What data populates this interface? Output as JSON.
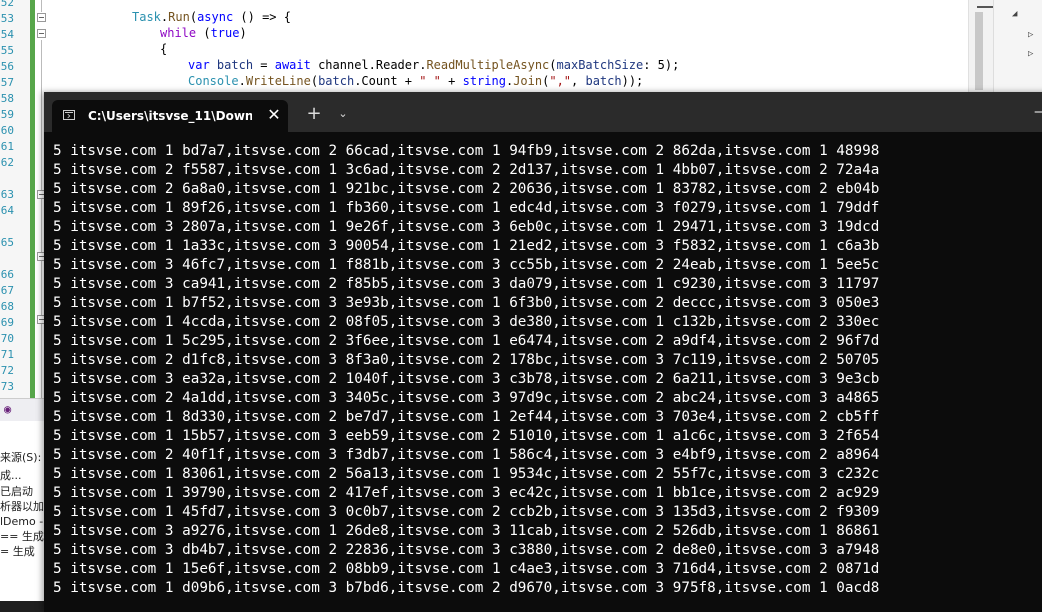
{
  "editor": {
    "line_numbers": [
      "52",
      "53",
      "54",
      "55",
      "56",
      "57",
      "58",
      "59",
      "60",
      "61",
      "62",
      "63",
      "64",
      "65",
      "66",
      "67",
      "68",
      "69",
      "70",
      "71",
      "72",
      "73"
    ],
    "code": {
      "line1": [
        "Task",
        ".",
        "Run",
        "(",
        "async",
        " () => {"
      ],
      "line2": [
        "while",
        " (",
        "true",
        ")"
      ],
      "line3": "{",
      "line4": [
        "var",
        " ",
        "batch",
        " = ",
        "await",
        " channel.Reader.",
        "ReadMultipleAsync",
        "(",
        "maxBatchSize",
        ": 5);"
      ],
      "line5": [
        "Console",
        ".",
        "WriteLine",
        "(",
        "batch",
        ".Count + ",
        "\" \"",
        " + ",
        "string",
        ".",
        "Join",
        "(",
        "\",\"",
        ", ",
        "batch",
        "));"
      ]
    }
  },
  "output_pane": {
    "lines": [
      "来源(S):",
      "成...",
      " 已启动",
      "析器以加",
      "lDemo -",
      "== 生成",
      "= 生成"
    ]
  },
  "terminal": {
    "tab_title": "C:\\Users\\itsvse_11\\Downloads\\",
    "close_glyph": "✕",
    "new_tab_glyph": "+",
    "dropdown_glyph": "⌄",
    "minimize_glyph": "—",
    "lines": [
      "5 itsvse.com 1 bd7a7,itsvse.com 2 66cad,itsvse.com 1 94fb9,itsvse.com 2 862da,itsvse.com 1 48998",
      "5 itsvse.com 2 f5587,itsvse.com 1 3c6ad,itsvse.com 2 2d137,itsvse.com 1 4bb07,itsvse.com 2 72a4a",
      "5 itsvse.com 2 6a8a0,itsvse.com 1 921bc,itsvse.com 2 20636,itsvse.com 1 83782,itsvse.com 2 eb04b",
      "5 itsvse.com 1 89f26,itsvse.com 1 fb360,itsvse.com 1 edc4d,itsvse.com 3 f0279,itsvse.com 1 79ddf",
      "5 itsvse.com 3 2807a,itsvse.com 1 9e26f,itsvse.com 3 6eb0c,itsvse.com 1 29471,itsvse.com 3 19dcd",
      "5 itsvse.com 1 1a33c,itsvse.com 3 90054,itsvse.com 1 21ed2,itsvse.com 3 f5832,itsvse.com 1 c6a3b",
      "5 itsvse.com 3 46fc7,itsvse.com 1 f881b,itsvse.com 3 cc55b,itsvse.com 2 24eab,itsvse.com 1 5ee5c",
      "5 itsvse.com 3 ca941,itsvse.com 2 f85b5,itsvse.com 3 da079,itsvse.com 1 c9230,itsvse.com 3 11797",
      "5 itsvse.com 1 b7f52,itsvse.com 3 3e93b,itsvse.com 1 6f3b0,itsvse.com 2 deccc,itsvse.com 3 050e3",
      "5 itsvse.com 1 4ccda,itsvse.com 2 08f05,itsvse.com 3 de380,itsvse.com 1 c132b,itsvse.com 2 330ec",
      "5 itsvse.com 1 5c295,itsvse.com 2 3f6ee,itsvse.com 1 e6474,itsvse.com 2 a9df4,itsvse.com 2 96f7d",
      "5 itsvse.com 2 d1fc8,itsvse.com 3 8f3a0,itsvse.com 2 178bc,itsvse.com 3 7c119,itsvse.com 2 50705",
      "5 itsvse.com 3 ea32a,itsvse.com 2 1040f,itsvse.com 3 c3b78,itsvse.com 2 6a211,itsvse.com 3 9e3cb",
      "5 itsvse.com 2 4a1dd,itsvse.com 3 3405c,itsvse.com 3 97d9c,itsvse.com 2 abc24,itsvse.com 3 a4865",
      "5 itsvse.com 1 8d330,itsvse.com 2 be7d7,itsvse.com 1 2ef44,itsvse.com 3 703e4,itsvse.com 2 cb5ff",
      "5 itsvse.com 1 15b57,itsvse.com 3 eeb59,itsvse.com 2 51010,itsvse.com 1 a1c6c,itsvse.com 3 2f654",
      "5 itsvse.com 2 40f1f,itsvse.com 3 f3db7,itsvse.com 1 586c4,itsvse.com 3 e4bf9,itsvse.com 2 a8964",
      "5 itsvse.com 1 83061,itsvse.com 2 56a13,itsvse.com 1 9534c,itsvse.com 2 55f7c,itsvse.com 3 c232c",
      "5 itsvse.com 1 39790,itsvse.com 2 417ef,itsvse.com 3 ec42c,itsvse.com 1 bb1ce,itsvse.com 2 ac929",
      "5 itsvse.com 1 45fd7,itsvse.com 3 0c0b7,itsvse.com 2 ccb2b,itsvse.com 3 135d3,itsvse.com 2 f9309",
      "5 itsvse.com 3 a9276,itsvse.com 1 26de8,itsvse.com 3 11cab,itsvse.com 2 526db,itsvse.com 1 86861",
      "5 itsvse.com 3 db4b7,itsvse.com 2 22836,itsvse.com 3 c3880,itsvse.com 2 de8e0,itsvse.com 3 a7948",
      "5 itsvse.com 1 15e6f,itsvse.com 2 08bb9,itsvse.com 1 c4ae3,itsvse.com 3 716d4,itsvse.com 2 0871d",
      "5 itsvse.com 1 d09b6,itsvse.com 3 b7bd6,itsvse.com 2 d9670,itsvse.com 3 975f8,itsvse.com 1 0acd8"
    ]
  }
}
